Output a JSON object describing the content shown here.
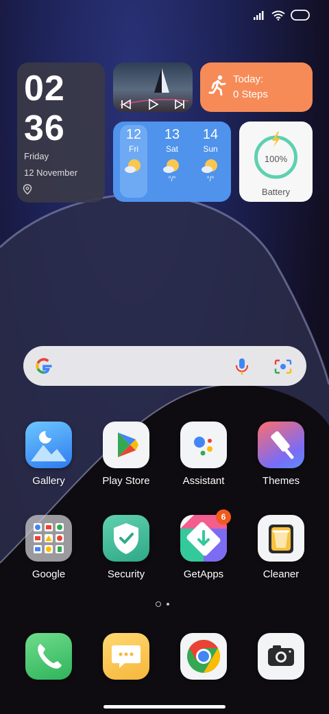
{
  "clock": {
    "hour": "02",
    "minute": "36",
    "weekday": "Friday",
    "date": "12 November"
  },
  "music": {
    "controls": [
      "previous-icon",
      "play-icon",
      "next-icon"
    ]
  },
  "steps": {
    "line1": "Today:",
    "line2": "0 Steps"
  },
  "weather": {
    "days": [
      {
        "num": "12",
        "name": "Fri",
        "temp": ""
      },
      {
        "num": "13",
        "name": "Sat",
        "temp": "°/°"
      },
      {
        "num": "14",
        "name": "Sun",
        "temp": "°/°"
      }
    ]
  },
  "battery": {
    "percent": "100%",
    "label": "Battery",
    "level": 1.0
  },
  "apps_row1": [
    {
      "label": "Gallery"
    },
    {
      "label": "Play Store"
    },
    {
      "label": "Assistant"
    },
    {
      "label": "Themes"
    }
  ],
  "apps_row2": [
    {
      "label": "Google"
    },
    {
      "label": "Security"
    },
    {
      "label": "GetApps",
      "badge": "6"
    },
    {
      "label": "Cleaner"
    }
  ],
  "dock": [
    "phone-icon",
    "messages-icon",
    "chrome-icon",
    "camera-icon"
  ],
  "colors": {
    "steps": "#f68b57",
    "weather": "#4f93ec",
    "battery_ring": "#5ed0b0",
    "badge": "#f05a1e"
  }
}
